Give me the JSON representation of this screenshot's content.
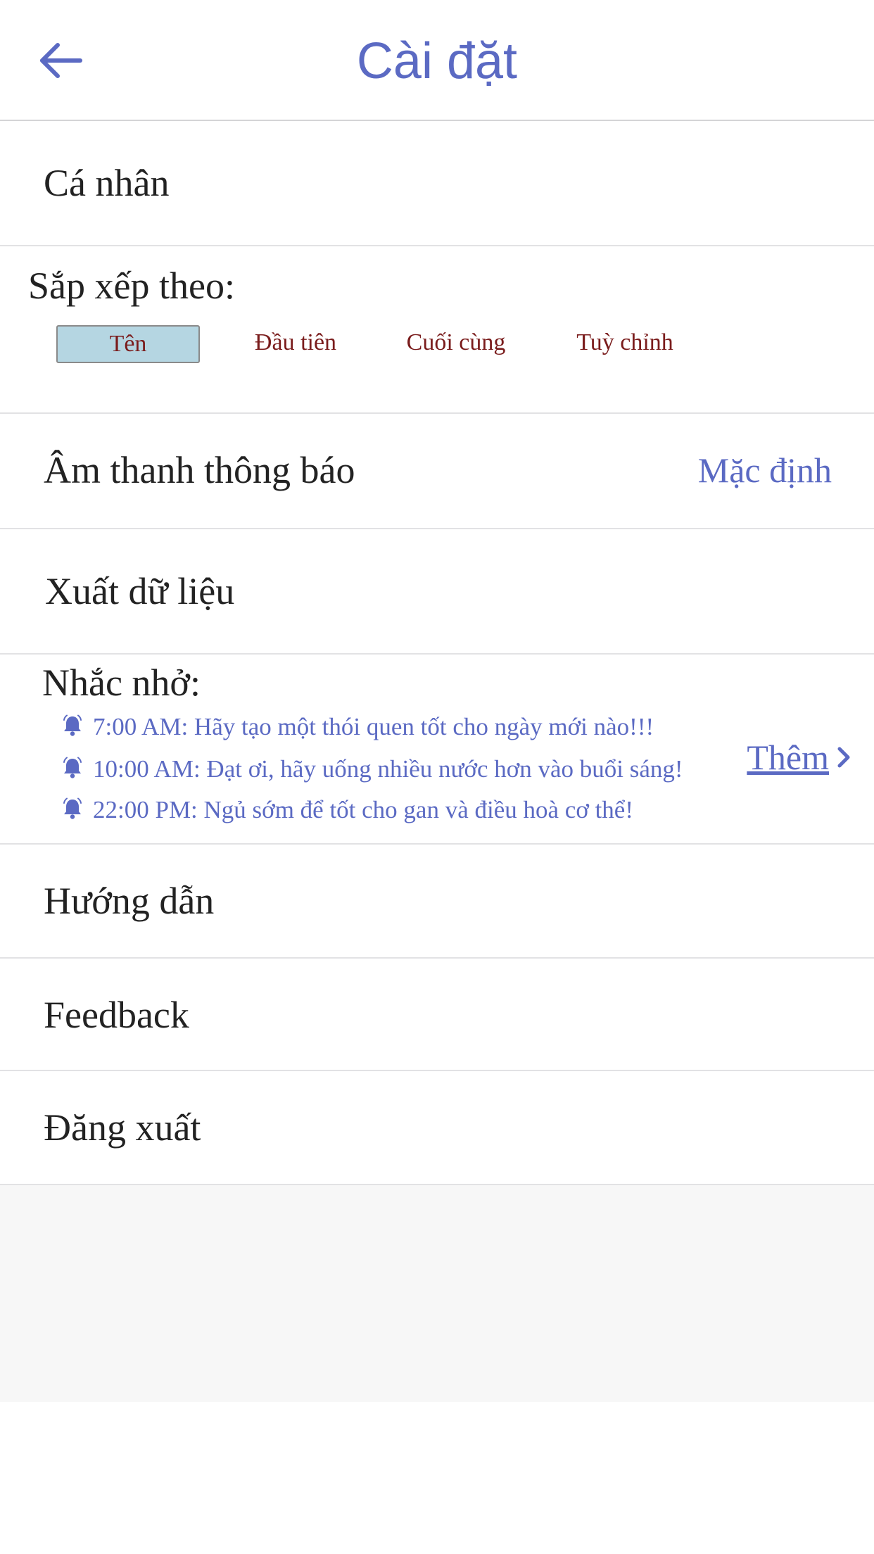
{
  "header": {
    "title": "Cài đặt"
  },
  "personal": {
    "label": "Cá nhân"
  },
  "sort": {
    "title": "Sắp xếp theo:",
    "options": [
      {
        "label": "Tên",
        "selected": true
      },
      {
        "label": "Đầu tiên",
        "selected": false
      },
      {
        "label": "Cuối cùng",
        "selected": false
      },
      {
        "label": "Tuỳ chỉnh",
        "selected": false
      }
    ]
  },
  "sound": {
    "label": "Âm thanh thông báo",
    "value": "Mặc định"
  },
  "export": {
    "label": "Xuất dữ liệu"
  },
  "reminders": {
    "title": "Nhắc nhở:",
    "items": [
      {
        "text": "7:00 AM: Hãy tạo một thói quen tốt cho ngày mới nào!!!"
      },
      {
        "text": "10:00 AM: Đạt ơi, hãy uống nhiều nước hơn vào buổi sáng!"
      },
      {
        "text": "22:00 PM: Ngủ sớm để tốt cho gan và điều hoà cơ thể!"
      }
    ],
    "more_label": "Thêm"
  },
  "guide": {
    "label": "Hướng dẫn"
  },
  "feedback": {
    "label": "Feedback"
  },
  "logout": {
    "label": "Đăng xuất"
  },
  "colors": {
    "accent": "#5b6ac3",
    "sort_option_text": "#7a1c1c",
    "sort_selected_bg": "#b5d6e2",
    "text": "#222222",
    "divider": "#e2e2e4"
  },
  "icons": {
    "back": "arrow-left-icon",
    "reminder": "bell-icon",
    "more": "chevron-right-icon"
  }
}
